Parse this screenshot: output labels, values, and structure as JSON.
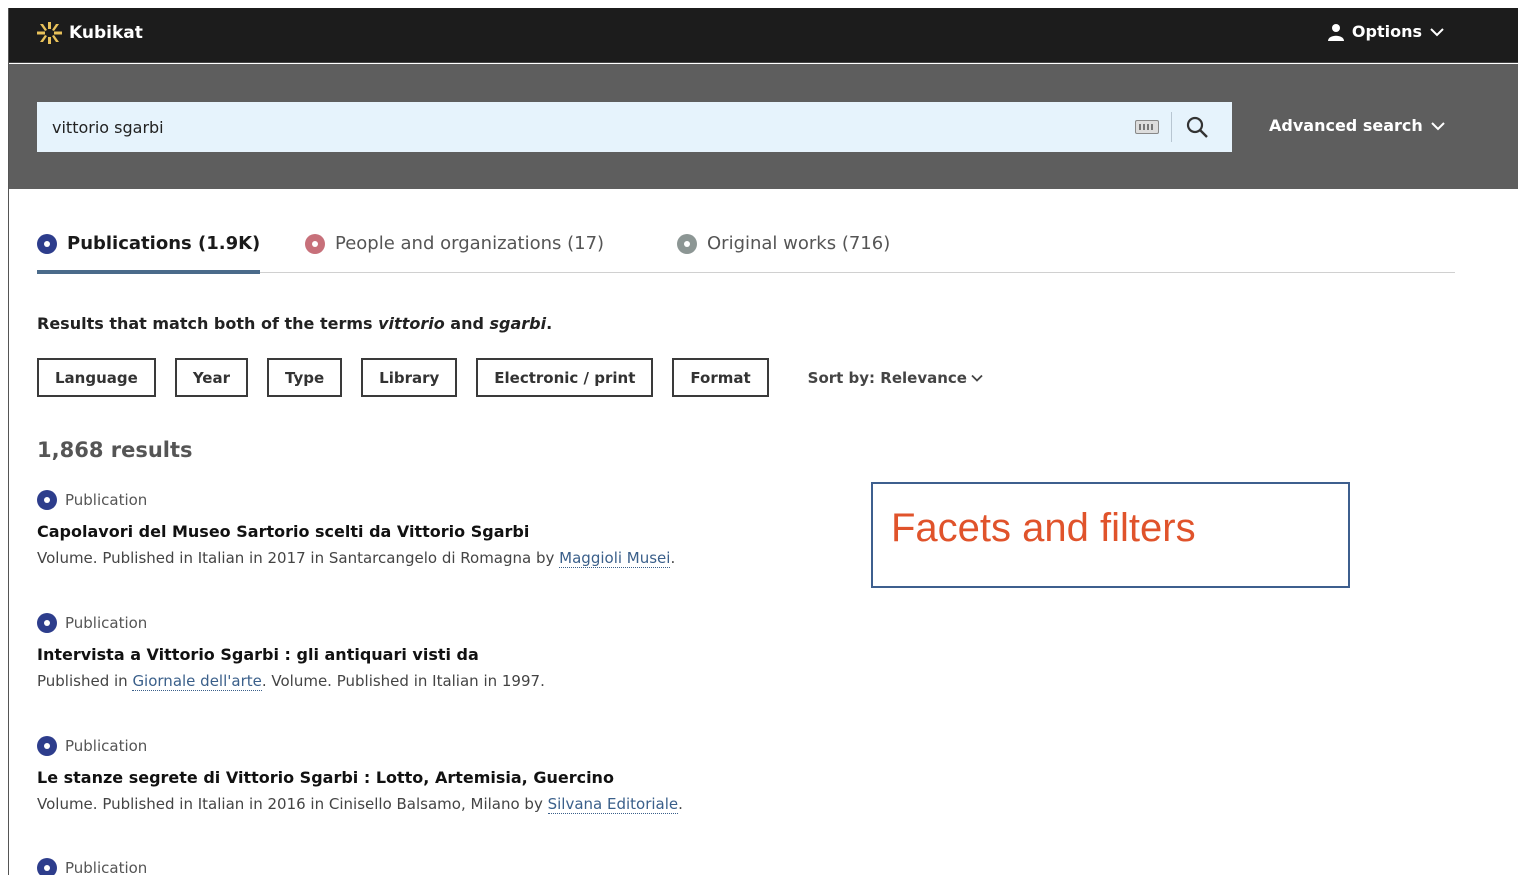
{
  "header": {
    "logo_text": "Kubikat",
    "options_label": "Options"
  },
  "search": {
    "value": "vittorio sgarbi",
    "advanced_label": "Advanced search"
  },
  "tabs": [
    {
      "label": "Publications (1.9K)",
      "active": true
    },
    {
      "label": "People and organizations (17)",
      "active": false
    },
    {
      "label": "Original works (716)",
      "active": false
    }
  ],
  "match": {
    "prefix": "Results that match both of the terms ",
    "term1": "vittorio",
    "joiner": " and ",
    "term2": "sgarbi",
    "suffix": "."
  },
  "facets": {
    "items": [
      "Language",
      "Year",
      "Type",
      "Library",
      "Electronic / print",
      "Format"
    ],
    "sort_label": "Sort by: Relevance"
  },
  "results_count": "1,868 results",
  "results": [
    {
      "type": "Publication",
      "title": "Capolavori del Museo Sartorio scelti da Vittorio Sgarbi",
      "desc_before": "Volume. Published in Italian in 2017 in Santarcangelo di Romagna by ",
      "link": "Maggioli Musei",
      "desc_after": "."
    },
    {
      "type": "Publication",
      "title": "Intervista a Vittorio Sgarbi : gli antiquari visti da",
      "desc_before": "Published in ",
      "link": "Giornale dell'arte",
      "desc_after": ". Volume. Published in Italian in 1997."
    },
    {
      "type": "Publication",
      "title": "Le stanze segrete di Vittorio Sgarbi : Lotto, Artemisia, Guercino",
      "desc_before": "Volume. Published in Italian in 2016 in Cinisello Balsamo, Milano by ",
      "link": "Silvana Editoriale",
      "desc_after": "."
    },
    {
      "type": "Publication"
    }
  ],
  "annotation": "Facets and filters",
  "colors": {
    "topbar": "#1c1c1c",
    "searchband": "#5e5e5e",
    "accent": "#2d3d8c",
    "annotation_text": "#e0532b"
  }
}
